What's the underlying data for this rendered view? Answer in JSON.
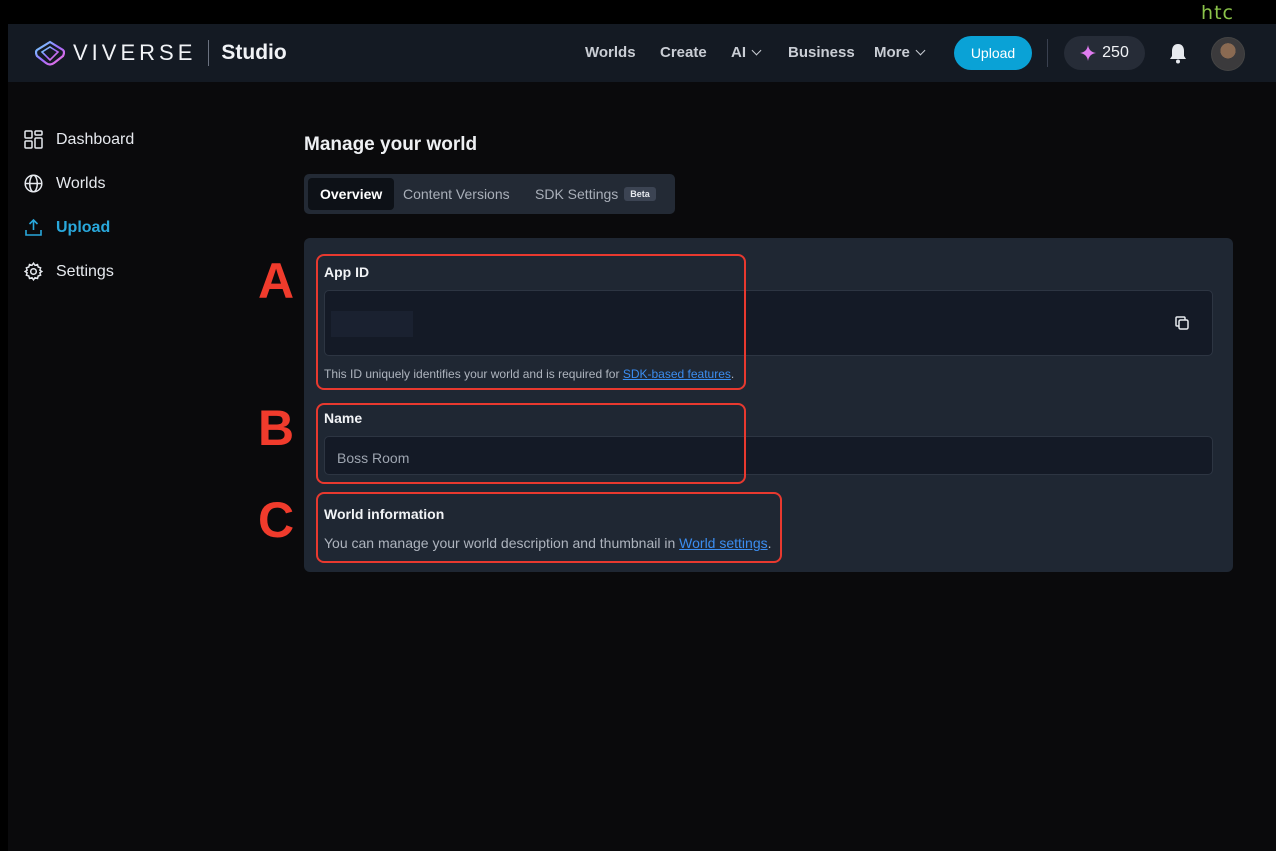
{
  "brand": {
    "corner_logo": "htc",
    "name": "VIVERSE",
    "product": "Studio"
  },
  "nav": {
    "worlds": "Worlds",
    "create": "Create",
    "ai": "AI",
    "business": "Business",
    "more": "More",
    "upload": "Upload",
    "credits": "250"
  },
  "sidebar": {
    "items": [
      {
        "label": "Dashboard",
        "icon": "dashboard-icon"
      },
      {
        "label": "Worlds",
        "icon": "globe-icon"
      },
      {
        "label": "Upload",
        "icon": "upload-icon",
        "active": true
      },
      {
        "label": "Settings",
        "icon": "gear-icon"
      }
    ]
  },
  "main": {
    "title": "Manage your world",
    "tabs": [
      {
        "label": "Overview",
        "active": true
      },
      {
        "label": "Content Versions"
      },
      {
        "label": "SDK Settings",
        "badge": "Beta"
      }
    ],
    "app_id": {
      "label": "App ID",
      "help_text": "This ID uniquely identifies your world and is required for ",
      "help_link": "SDK-based features",
      "help_end": "."
    },
    "name": {
      "label": "Name",
      "value": "Boss Room"
    },
    "world_info": {
      "label": "World information",
      "text": "You can manage your world description and thumbnail in ",
      "link": "World settings",
      "end": "."
    }
  },
  "annotations": {
    "a": "A",
    "b": "B",
    "c": "C"
  },
  "colors": {
    "accent": "#0aa2d6",
    "active_nav": "#29a8dc",
    "highlight": "#e8392f",
    "link": "#3b8df0"
  }
}
